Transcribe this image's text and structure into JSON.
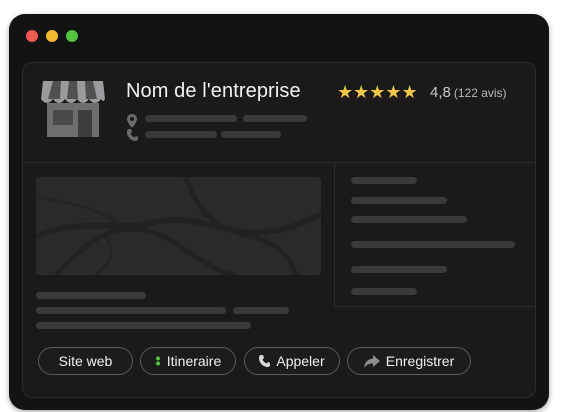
{
  "window": {
    "controls": [
      "close",
      "minimize",
      "maximize"
    ]
  },
  "business": {
    "name": "Nom de l'entreprise",
    "stars": "★★★★★",
    "rating": "4,8",
    "reviews": "(122 avis)",
    "icons": [
      "store-icon",
      "location-pin-icon",
      "phone-icon"
    ]
  },
  "actions": {
    "website_label": "Site web",
    "directions_label": "Itineraire",
    "call_label": "Appeler",
    "save_label": "Enregistrer"
  },
  "colors": {
    "star": "#f1c74a",
    "window_bg": "#131313",
    "close": "#ee5a52",
    "minimize": "#f1b731",
    "maximize": "#53c23d"
  }
}
